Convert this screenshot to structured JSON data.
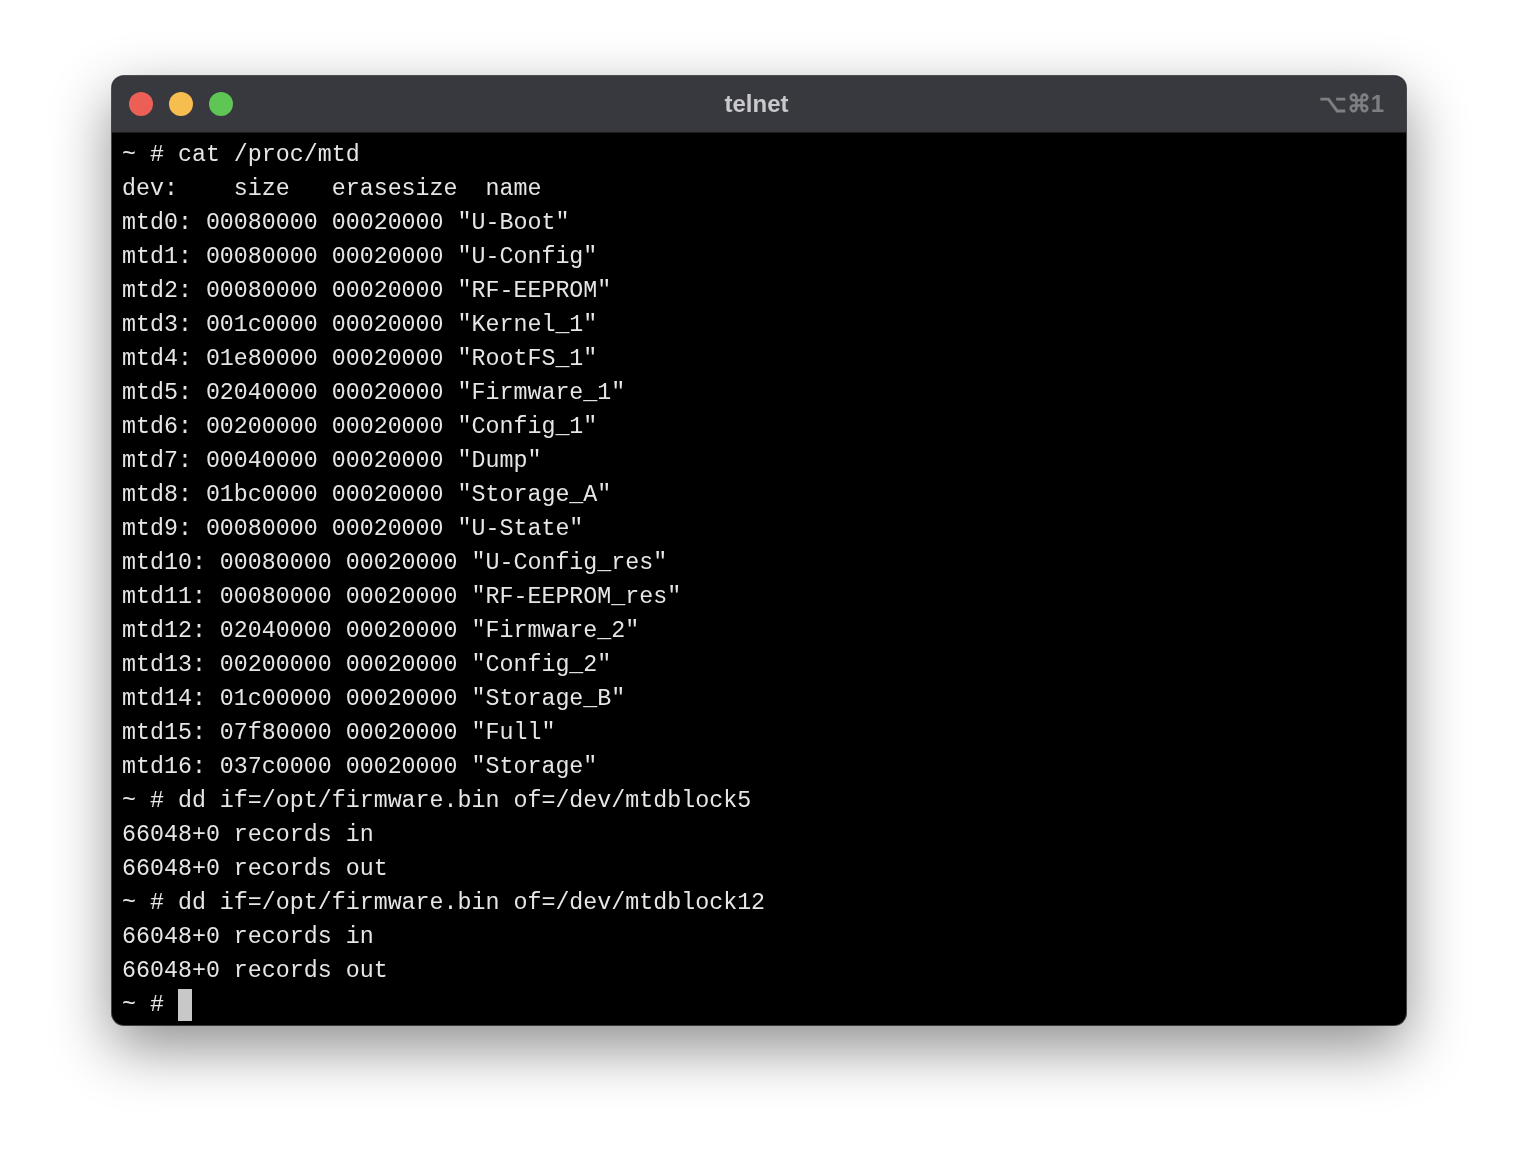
{
  "window": {
    "title": "telnet",
    "shortcut": "⌥⌘1"
  },
  "terminal": {
    "lines": [
      "~ # cat /proc/mtd",
      "dev:    size   erasesize  name",
      "mtd0: 00080000 00020000 \"U-Boot\"",
      "mtd1: 00080000 00020000 \"U-Config\"",
      "mtd2: 00080000 00020000 \"RF-EEPROM\"",
      "mtd3: 001c0000 00020000 \"Kernel_1\"",
      "mtd4: 01e80000 00020000 \"RootFS_1\"",
      "mtd5: 02040000 00020000 \"Firmware_1\"",
      "mtd6: 00200000 00020000 \"Config_1\"",
      "mtd7: 00040000 00020000 \"Dump\"",
      "mtd8: 01bc0000 00020000 \"Storage_A\"",
      "mtd9: 00080000 00020000 \"U-State\"",
      "mtd10: 00080000 00020000 \"U-Config_res\"",
      "mtd11: 00080000 00020000 \"RF-EEPROM_res\"",
      "mtd12: 02040000 00020000 \"Firmware_2\"",
      "mtd13: 00200000 00020000 \"Config_2\"",
      "mtd14: 01c00000 00020000 \"Storage_B\"",
      "mtd15: 07f80000 00020000 \"Full\"",
      "mtd16: 037c0000 00020000 \"Storage\"",
      "~ # dd if=/opt/firmware.bin of=/dev/mtdblock5",
      "66048+0 records in",
      "66048+0 records out",
      "~ # dd if=/opt/firmware.bin of=/dev/mtdblock12",
      "66048+0 records in",
      "66048+0 records out"
    ],
    "prompt": "~ #"
  }
}
